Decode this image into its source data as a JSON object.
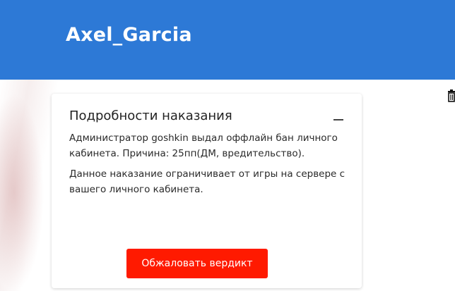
{
  "header": {
    "username": "Axel_Garcia",
    "background_color": "#2d79d6"
  },
  "punishment_card": {
    "title": "Подробности наказания",
    "collapse_icon": "minus-icon",
    "paragraphs": [
      "Администратор goshkin выдал оффлайн бан личного кабинета. Причина: 25пп(ДМ, вредительство).",
      "Данное наказание ограничивает от игры на сервере с вашего личного кабинета."
    ],
    "appeal_button_label": "Обжаловать вердикт",
    "appeal_button_color": "#ff1a00"
  },
  "side_icon": "trash-icon"
}
